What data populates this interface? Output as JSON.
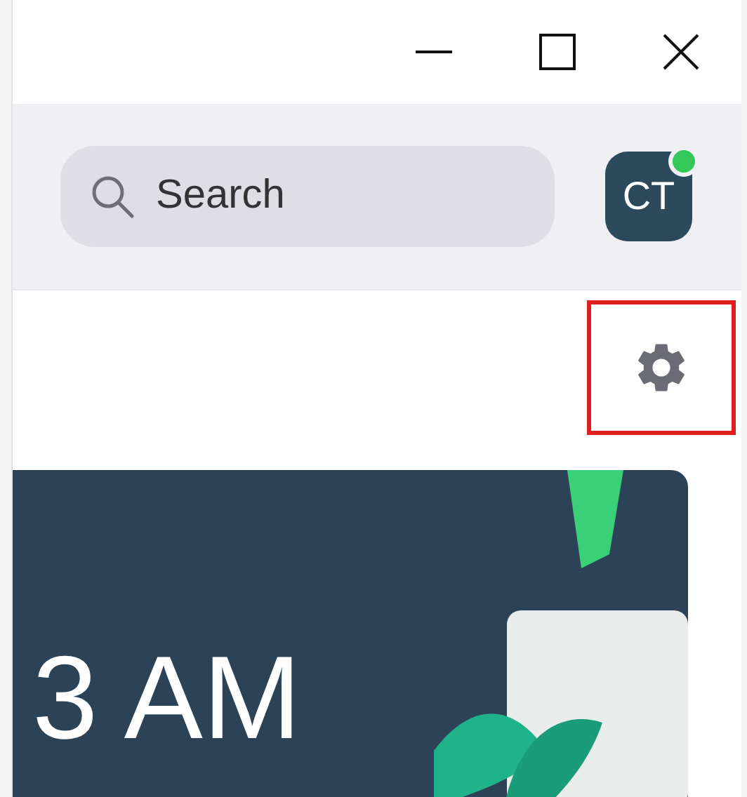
{
  "search": {
    "placeholder": "Search"
  },
  "avatar": {
    "initials": "CT",
    "online": true
  },
  "card": {
    "time": "3 AM"
  }
}
